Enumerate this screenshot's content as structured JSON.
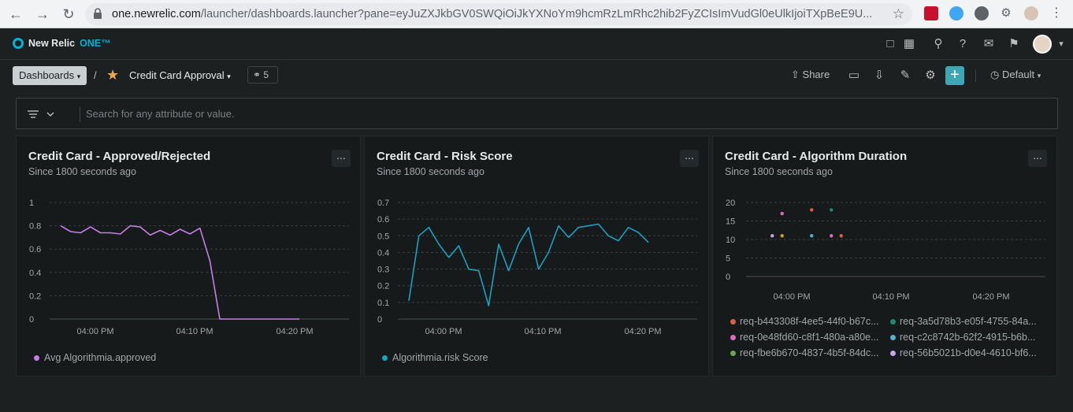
{
  "browser": {
    "url_host": "one.newrelic.com",
    "url_path": "/launcher/dashboards.launcher?pane=eyJuZXJkbGV0SWQiOiJkYXNoYm9hcmRzLmRhc2hib2FyZCIsImVudGl0eUlkIjoiTXpBeE9U..."
  },
  "app": {
    "logo_text": "New Relic",
    "logo_one": "ONE™"
  },
  "toolbar": {
    "breadcrumb_root": "Dashboards",
    "separator": "/",
    "dashboard_title": "Credit Card Approval",
    "tag_count": "5",
    "share_label": "Share",
    "time_picker_label": "Default"
  },
  "filter": {
    "placeholder": "Search for any attribute or value."
  },
  "panels": [
    {
      "title": "Credit Card - Approved/Rejected",
      "subtitle": "Since 1800 seconds ago",
      "menu": "...",
      "legend": [
        {
          "label": "Avg Algorithmia.approved",
          "color": "#c67de3"
        }
      ]
    },
    {
      "title": "Credit Card - Risk Score",
      "subtitle": "Since 1800 seconds ago",
      "menu": "...",
      "legend": [
        {
          "label": "Algorithmia.risk Score",
          "color": "#1ba1c1"
        }
      ]
    },
    {
      "title": "Credit Card - Algorithm Duration",
      "subtitle": "Since 1800 seconds ago",
      "menu": "...",
      "legend": [
        {
          "label": "req-b443308f-4ee5-44f0-b67c...",
          "color": "#e15f41"
        },
        {
          "label": "req-3a5d78b3-e05f-4755-84a...",
          "color": "#1c8a6f"
        },
        {
          "label": "req-0e48fd60-c8f1-480a-a80e...",
          "color": "#e667c3"
        },
        {
          "label": "req-c2c8742b-62f2-4915-b6b...",
          "color": "#52b0d8"
        },
        {
          "label": "req-fbe6b670-4837-4b5f-84dc...",
          "color": "#6aa84f"
        },
        {
          "label": "req-56b5021b-d0e4-4610-bf6...",
          "color": "#c9a4e8"
        }
      ]
    }
  ],
  "chart_data": [
    {
      "type": "line",
      "title": "Credit Card - Approved/Rejected",
      "x_ticks": [
        "04:00 PM",
        "04:10 PM",
        "04:20 PM"
      ],
      "y_ticks": [
        "0",
        "0.2",
        "0.4",
        "0.6",
        "0.8",
        "1"
      ],
      "ylim": [
        0,
        1
      ],
      "series": [
        {
          "name": "Avg Algorithmia.approved",
          "color": "#c67de3",
          "values": [
            0.8,
            0.75,
            0.74,
            0.79,
            0.74,
            0.74,
            0.73,
            0.8,
            0.79,
            0.72,
            0.76,
            0.72,
            0.77,
            0.73,
            0.78,
            0.5,
            0,
            0,
            0,
            0,
            0,
            0,
            0,
            0,
            0
          ]
        }
      ]
    },
    {
      "type": "line",
      "title": "Credit Card - Risk Score",
      "x_ticks": [
        "04:00 PM",
        "04:10 PM",
        "04:20 PM"
      ],
      "y_ticks": [
        "0",
        "0.1",
        "0.2",
        "0.3",
        "0.4",
        "0.5",
        "0.6",
        "0.7"
      ],
      "ylim": [
        0,
        0.7
      ],
      "series": [
        {
          "name": "Algorithmia.risk Score",
          "color": "#1ba1c1",
          "values": [
            0.11,
            0.5,
            0.55,
            0.45,
            0.37,
            0.44,
            0.3,
            0.29,
            0.08,
            0.45,
            0.29,
            0.45,
            0.55,
            0.3,
            0.4,
            0.56,
            0.49,
            0.55,
            0.56,
            0.57,
            0.5,
            0.47,
            0.55,
            0.52,
            0.46
          ]
        }
      ]
    },
    {
      "type": "scatter",
      "title": "Credit Card - Algorithm Duration",
      "x_ticks": [
        "04:00 PM",
        "04:10 PM",
        "04:20 PM"
      ],
      "y_ticks": [
        "0",
        "5",
        "10",
        "15",
        "20"
      ],
      "ylim": [
        0,
        20
      ],
      "points": [
        {
          "x": 0.5,
          "y": 11,
          "color": "#c9a4e8"
        },
        {
          "x": 1.5,
          "y": 17,
          "color": "#e667c3"
        },
        {
          "x": 1.5,
          "y": 11,
          "color": "#d5a11e"
        },
        {
          "x": 4.5,
          "y": 18,
          "color": "#e15f41"
        },
        {
          "x": 4.5,
          "y": 11,
          "color": "#52b0d8"
        },
        {
          "x": 6.5,
          "y": 18,
          "color": "#1c8a6f"
        },
        {
          "x": 6.5,
          "y": 11,
          "color": "#e667c3"
        },
        {
          "x": 7.5,
          "y": 11,
          "color": "#e15f41"
        }
      ]
    }
  ]
}
